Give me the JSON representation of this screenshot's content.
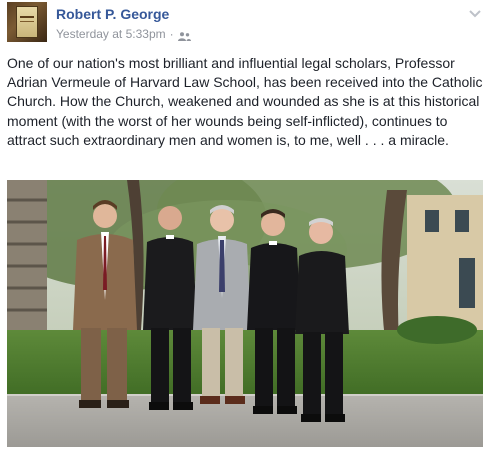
{
  "post": {
    "author": "Robert P. George",
    "timestamp": "Yesterday at 5:33pm",
    "separator": "·",
    "audience_icon": "friends-icon",
    "menu_icon": "chevron-down-icon",
    "text": "One of our nation's most brilliant and influential legal scholars, Professor Adrian Vermeule of Harvard Law School, has been received into the Catholic Church. How the Church, weakened and wounded as she is at this historical moment (with the worst of her wounds being self-inflicted), continues to attract such extraordinary men and women is, to me, well . . . a miracle."
  },
  "colors": {
    "author_link": "#365899",
    "meta_text": "#90949c",
    "body_text": "#1d2129"
  }
}
